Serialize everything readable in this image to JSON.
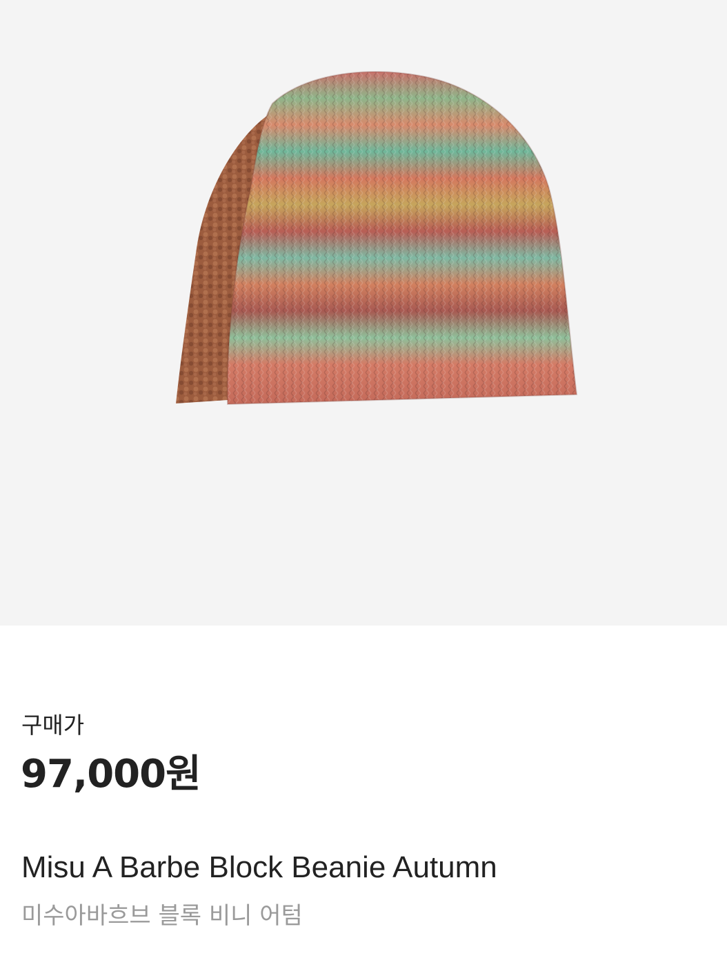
{
  "product": {
    "image_alt_icon": "knit-beanie-image",
    "price_label": "구매가",
    "price": "97,000원",
    "name_en": "Misu A Barbe Block Beanie Autumn",
    "name_ko": "미수아바흐브 블록 비니 어텀"
  },
  "colors": {
    "image_background": "#f4f4f4",
    "text_primary": "#222222",
    "text_secondary": "#9a9a9a",
    "beanie_base": "#c86e5e",
    "fleece_brown": "#9c5c3e"
  }
}
